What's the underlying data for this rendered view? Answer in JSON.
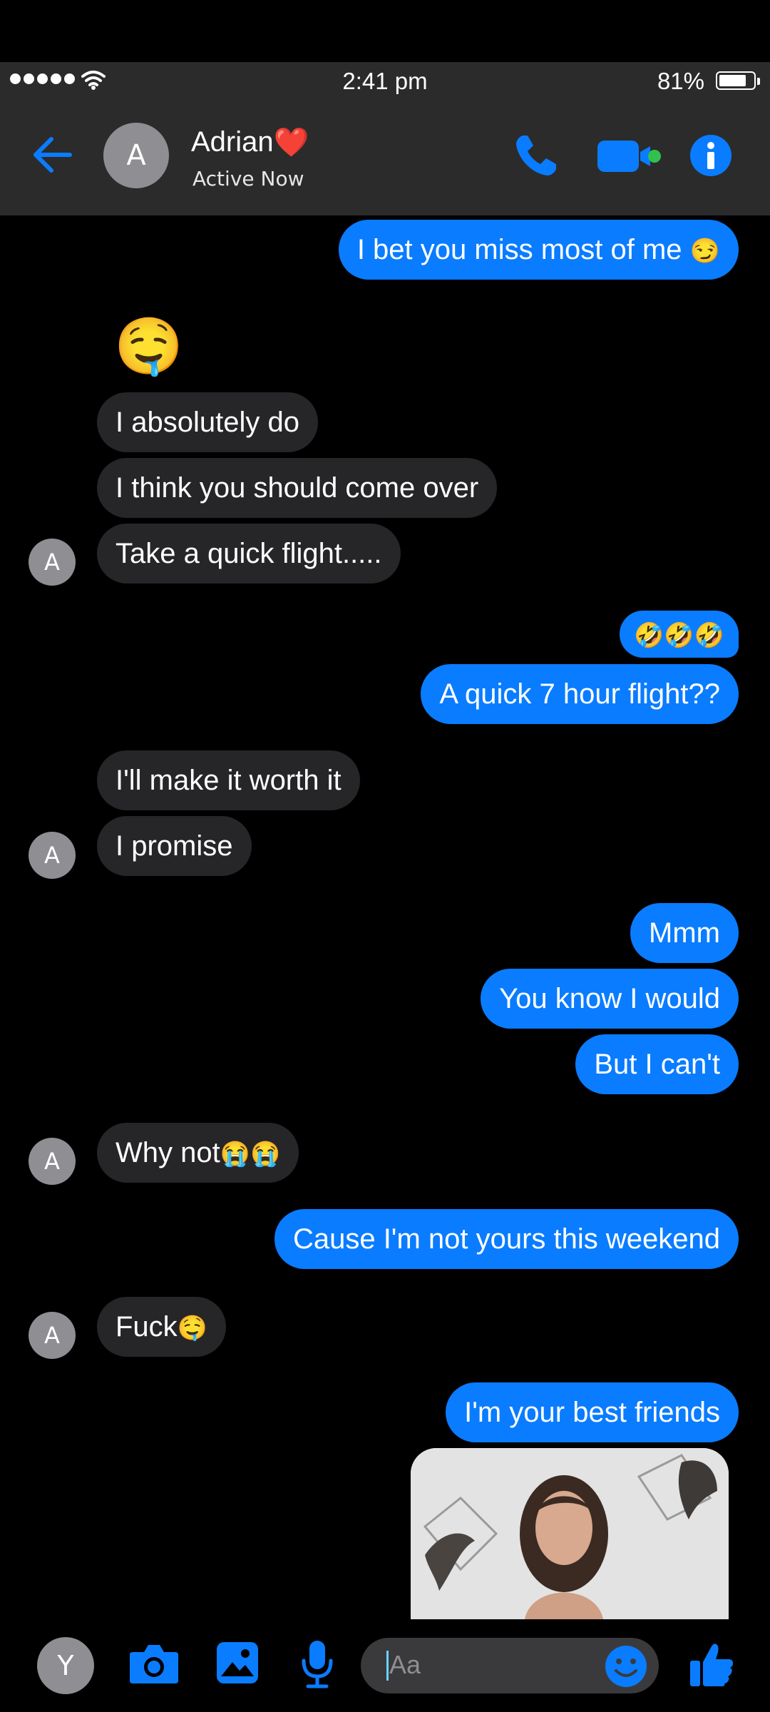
{
  "status_bar": {
    "time": "2:41 pm",
    "battery": "81%",
    "battery_level": 0.81
  },
  "header": {
    "avatar_initial": "A",
    "name": "Adrian",
    "heart": "❤️",
    "status": "Active Now"
  },
  "icons": {
    "back": "back-arrow-icon",
    "call": "phone-icon",
    "video": "video-call-icon",
    "info": "info-icon",
    "camera": "camera-icon",
    "gallery": "gallery-icon",
    "mic": "microphone-icon",
    "emoji": "smiley-icon",
    "like": "thumbs-up-icon"
  },
  "colors": {
    "accent": "#0a7cff",
    "sent_bubble": "#0a7cff",
    "received_bubble": "#262628",
    "background": "#000000"
  },
  "messages": [
    {
      "dir": "sent",
      "text": "I bet you miss most of me",
      "emoji": "😏"
    },
    {
      "dir": "recv",
      "text": "🤤",
      "big_emoji": true
    },
    {
      "dir": "recv",
      "text": "I absolutely do"
    },
    {
      "dir": "recv",
      "text": "I think you should come over"
    },
    {
      "dir": "recv",
      "text": "Take a quick flight.....",
      "avatar": "A"
    },
    {
      "dir": "sent",
      "text": "🤣🤣🤣"
    },
    {
      "dir": "sent",
      "text": "A quick 7 hour flight??"
    },
    {
      "dir": "recv",
      "text": "I'll make it worth it"
    },
    {
      "dir": "recv",
      "text": "I promise",
      "avatar": "A"
    },
    {
      "dir": "sent",
      "text": "Mmm"
    },
    {
      "dir": "sent",
      "text": "You know I would"
    },
    {
      "dir": "sent",
      "text": "But I can't"
    },
    {
      "dir": "recv",
      "text": "Why not",
      "emoji": "😭😭",
      "avatar": "A"
    },
    {
      "dir": "sent",
      "text": "Cause I'm not yours this weekend"
    },
    {
      "dir": "recv",
      "text": "Fuck",
      "emoji": "🤤",
      "avatar": "A"
    },
    {
      "dir": "sent",
      "text": "I'm your best friends"
    }
  ],
  "composer": {
    "me_initial": "Y",
    "placeholder": "Aa"
  }
}
